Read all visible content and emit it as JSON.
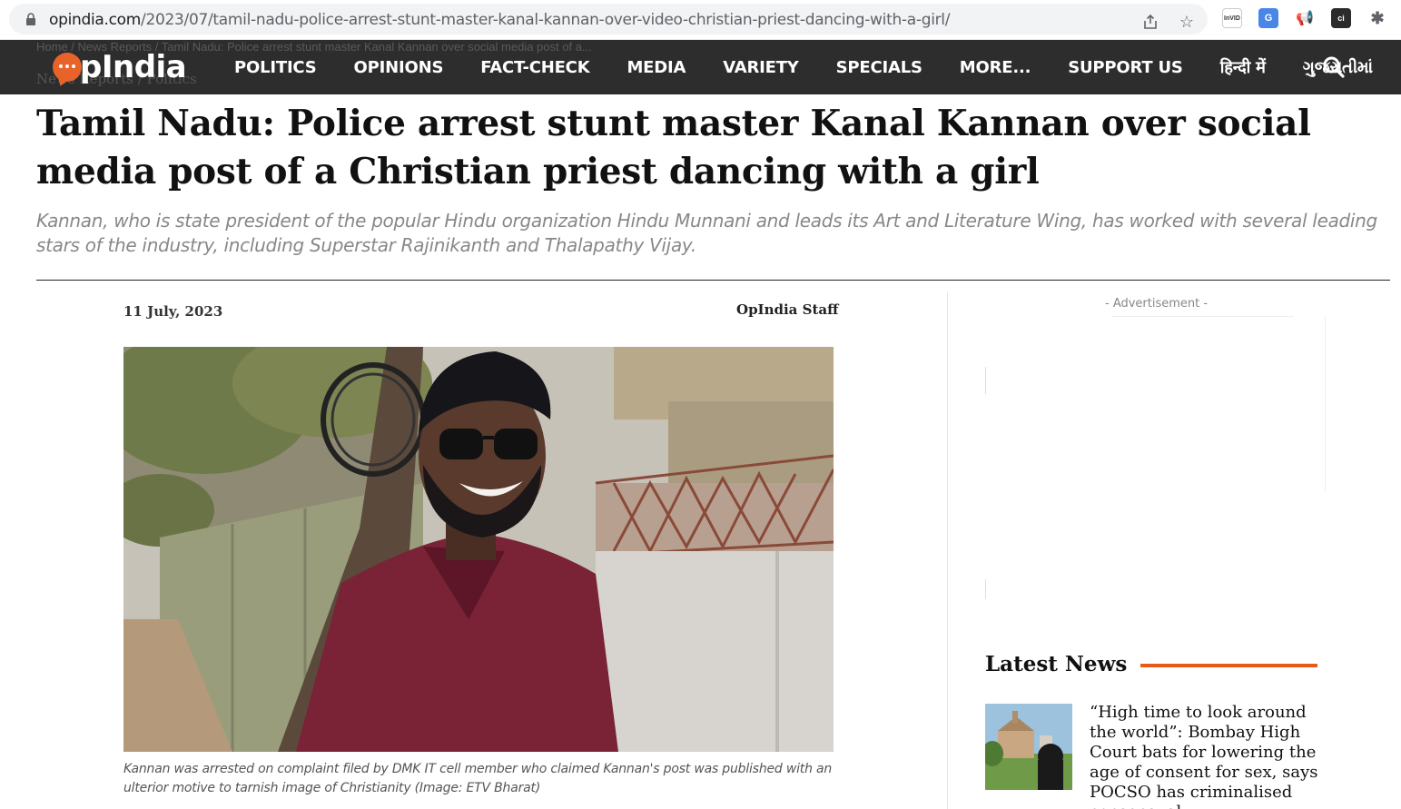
{
  "browser": {
    "url_domain": "opindia.com",
    "url_path": "/2023/07/tamil-nadu-police-arrest-stunt-master-kanal-kannan-over-video-christian-priest-dancing-with-a-girl/",
    "ext_invid": "InVID",
    "ext_ci": "ci"
  },
  "site": {
    "logo_text": "pIndia",
    "nav": [
      "POLITICS",
      "OPINIONS",
      "FACT-CHECK",
      "MEDIA",
      "VARIETY",
      "SPECIALS",
      "MORE...",
      "SUPPORT US",
      "हिन्दी में",
      "ગુજરાતીમાં"
    ],
    "ghost_breadcrumb_line": "Home / News Reports / Tamil Nadu: Police arrest stunt master Kanal Kannan over social media post of a...",
    "ghost_breadcrumb": "News Reports / Politics",
    "brand_color": "#e8632a"
  },
  "article": {
    "title": "Tamil Nadu: Police arrest stunt master Kanal Kannan over social media post of a Christian priest dancing with a girl",
    "subtitle": "Kannan, who is state president of the popular Hindu organization Hindu Munnani and leads its Art and Literature Wing, has worked with several leading stars of the industry, including Superstar Rajinikanth and Thalapathy Vijay.",
    "date": "11 July, 2023",
    "author": "OpIndia Staff",
    "caption": "Kannan was arrested on complaint filed by DMK IT cell member who claimed Kannan's post was published with an ulterior motive to tarnish image of Christianity (Image: ETV Bharat)"
  },
  "sidebar": {
    "ad_label": "- Advertisement -",
    "latest_title": "Latest News",
    "latest_items": [
      {
        "headline": "“High time to look around the world”: Bombay High Court bats for lowering the age of consent for sex, says POCSO has criminalised consensual"
      }
    ],
    "accent_color": "#e85a1a"
  }
}
